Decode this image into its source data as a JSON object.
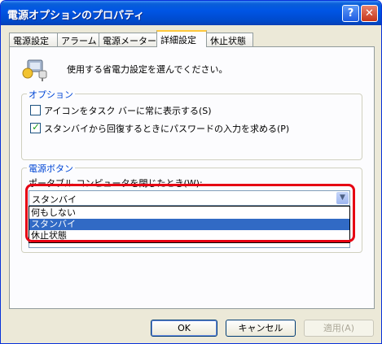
{
  "window": {
    "title": "電源オプションのプロパティ",
    "help_label": "?",
    "close_label": "✕"
  },
  "tabs": [
    {
      "label": "電源設定"
    },
    {
      "label": "アラーム"
    },
    {
      "label": "電源メーター"
    },
    {
      "label": "詳細設定",
      "active": true
    },
    {
      "label": "休止状態"
    }
  ],
  "header": {
    "icon": "power-plug-computer-icon",
    "text": "使用する省電力設定を選んでください。"
  },
  "options_group": {
    "legend": "オプション",
    "items": [
      {
        "label": "アイコンをタスク バーに常に表示する(S)",
        "checked": false
      },
      {
        "label": "スタンバイから回復するときにパスワードの入力を求める(P)",
        "checked": true
      }
    ]
  },
  "power_button_group": {
    "legend": "電源ボタン",
    "combo_label": "ポータブル コンピュータを閉じたとき(W):",
    "combo_value": "スタンバイ",
    "options": [
      "何もしない",
      "スタンバイ",
      "休止状態"
    ],
    "selected_index": 1
  },
  "highlight_color": "#e60012",
  "buttons": {
    "ok": "OK",
    "cancel": "キャンセル",
    "apply": "適用(A)"
  }
}
